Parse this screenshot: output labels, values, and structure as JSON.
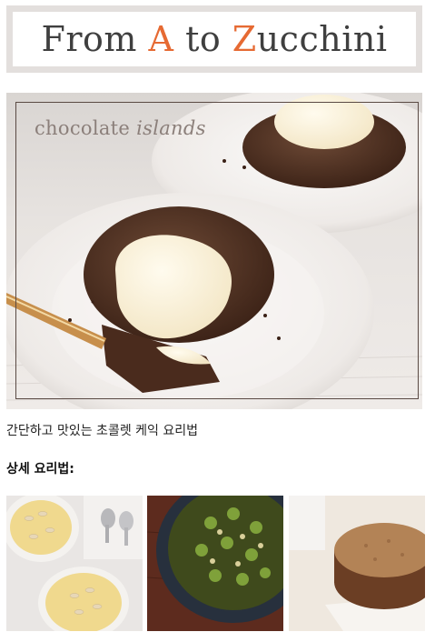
{
  "header": {
    "title_part1": "From ",
    "title_a": "A",
    "title_part2": " to ",
    "title_z": "Z",
    "title_part3": "ucchini",
    "accent_color": "#e66a33"
  },
  "hero": {
    "caption_plain": "chocolate ",
    "caption_italic": "islands"
  },
  "article": {
    "description": "간단하고 맛있는 초콜렛 케익 요리법",
    "detail_heading": "상세 요리법:"
  },
  "related": [
    {
      "name": "almond-pudding-thumbnail"
    },
    {
      "name": "brussels-sprouts-thumbnail"
    },
    {
      "name": "almond-cake-thumbnail"
    }
  ]
}
